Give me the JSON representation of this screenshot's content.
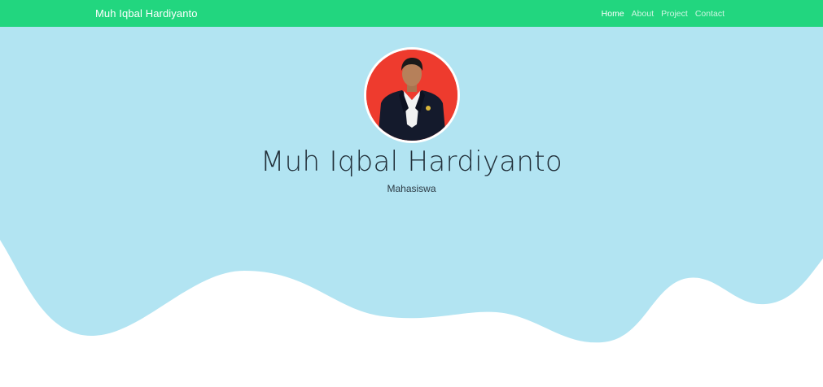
{
  "navbar": {
    "brand": "Muh Iqbal Hardiyanto",
    "links": [
      {
        "label": "Home",
        "active": true
      },
      {
        "label": "About",
        "active": false
      },
      {
        "label": "Project",
        "active": false
      },
      {
        "label": "Contact",
        "active": false
      }
    ],
    "background_color": "#22d67f"
  },
  "hero": {
    "name": "Muh Iqbal Hardiyanto",
    "role": "Mahasiswa",
    "background_color": "#b2e4f2",
    "avatar_background_color": "#ee3b2e"
  }
}
